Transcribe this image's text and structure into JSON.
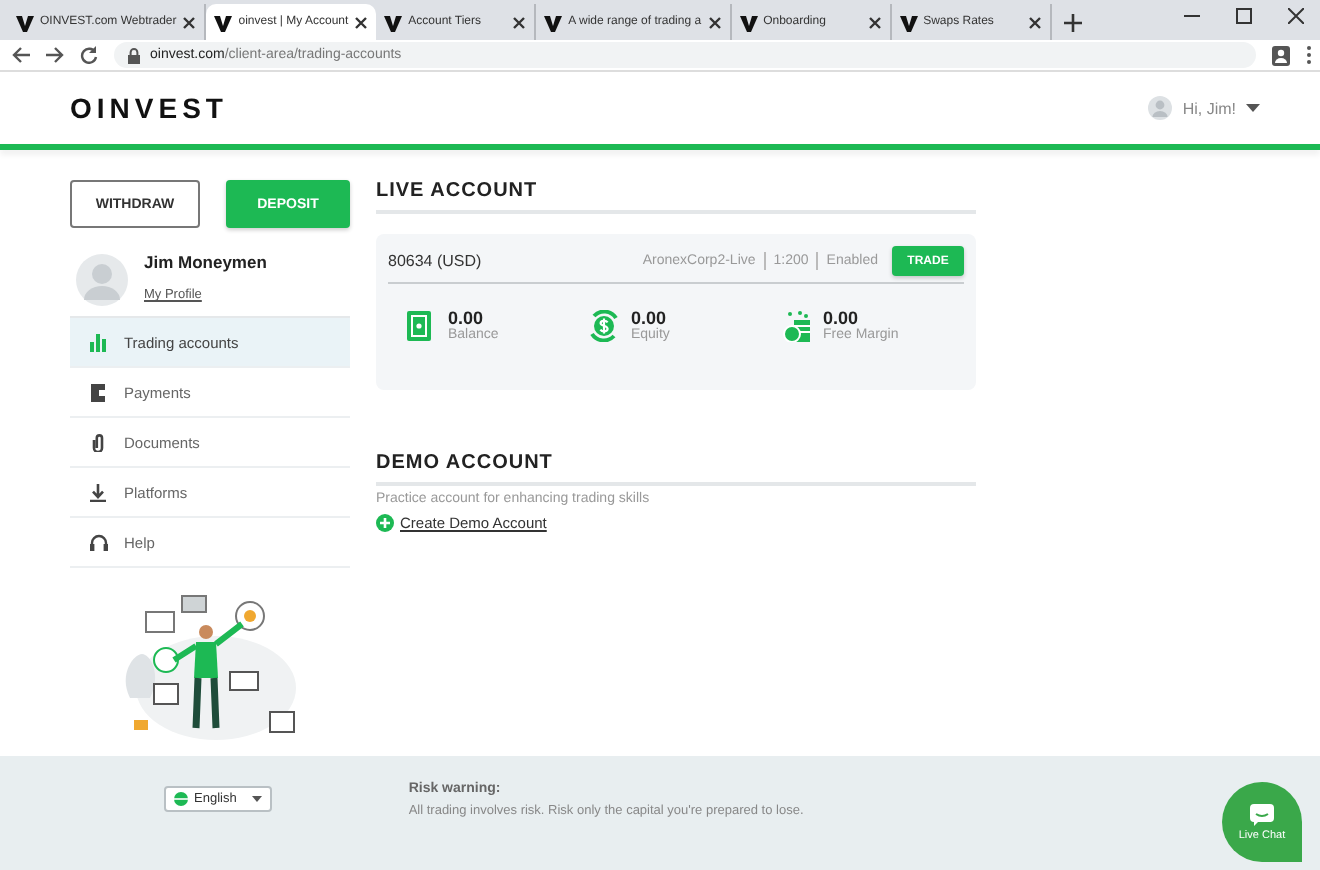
{
  "browser": {
    "tabs": [
      {
        "title": "OINVEST.com Webtrader",
        "selected": false
      },
      {
        "title": "oinvest | My Account",
        "selected": true
      },
      {
        "title": "Account Tiers",
        "selected": false
      },
      {
        "title": "A wide range of trading a",
        "selected": false
      },
      {
        "title": "Onboarding",
        "selected": false
      },
      {
        "title": "Swaps Rates",
        "selected": false
      }
    ],
    "url_host": "oinvest.com",
    "url_path": "/client-area/trading-accounts"
  },
  "header": {
    "logo": "OINVEST",
    "greeting": "Hi, Jim!"
  },
  "actions": [
    "WITHDRAW",
    "DEPOSIT"
  ],
  "profile": {
    "name": "Jim Moneymen",
    "link": "My Profile"
  },
  "sidebar": {
    "items": [
      {
        "label": "Trading accounts",
        "selected": true
      },
      {
        "label": "Payments",
        "selected": false
      },
      {
        "label": "Documents",
        "selected": false
      },
      {
        "label": "Platforms",
        "selected": false
      },
      {
        "label": "Help",
        "selected": false
      }
    ]
  },
  "live_account": {
    "heading": "LIVE ACCOUNT",
    "account": "80634 (USD)",
    "server": "AronexCorp2-Live",
    "leverage": "1:200",
    "status": "Enabled",
    "trade_button": "TRADE",
    "stats": [
      {
        "value": "0.00",
        "label": "Balance"
      },
      {
        "value": "0.00",
        "label": "Equity"
      },
      {
        "value": "0.00",
        "label": "Free Margin"
      }
    ]
  },
  "demo_account": {
    "heading": "DEMO ACCOUNT",
    "description": "Practice account for enhancing trading skills",
    "create_link": "Create Demo Account"
  },
  "footer": {
    "language": "English",
    "risk_title": "Risk warning:",
    "risk_text": "All trading involves risk. Risk only the capital you're prepared to lose.",
    "chat": "Live Chat"
  }
}
